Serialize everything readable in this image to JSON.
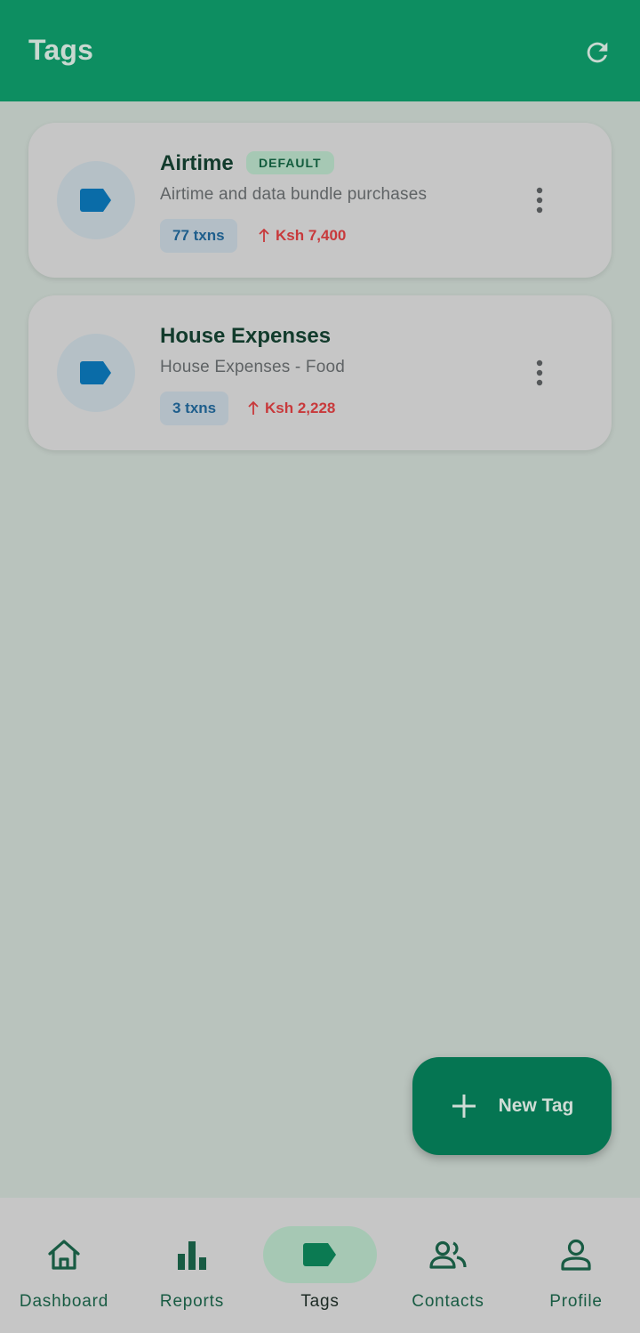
{
  "appbar": {
    "title": "Tags",
    "refresh_icon": "refresh-icon"
  },
  "tags": [
    {
      "name": "Airtime",
      "badge": "DEFAULT",
      "description": "Airtime and data bundle purchases",
      "txns": "77 txns",
      "amount": "Ksh 7,400",
      "icon": "label-icon"
    },
    {
      "name": "House Expenses",
      "badge": "",
      "description": "House Expenses - Food",
      "txns": "3 txns",
      "amount": "Ksh 2,228",
      "icon": "label-icon"
    }
  ],
  "fab": {
    "label": "New Tag",
    "icon": "plus-icon"
  },
  "nav": {
    "items": [
      {
        "label": "Dashboard",
        "icon": "home-icon"
      },
      {
        "label": "Reports",
        "icon": "bar-chart-icon"
      },
      {
        "label": "Tags",
        "icon": "label-icon",
        "active": true
      },
      {
        "label": "Contacts",
        "icon": "people-icon"
      },
      {
        "label": "Profile",
        "icon": "person-icon"
      }
    ]
  },
  "colors": {
    "primary": "#0d8e61",
    "fab": "#057552",
    "amount": "#c8393b",
    "chip_text": "#1e5e8c",
    "tag_icon": "#0a6ca8"
  }
}
